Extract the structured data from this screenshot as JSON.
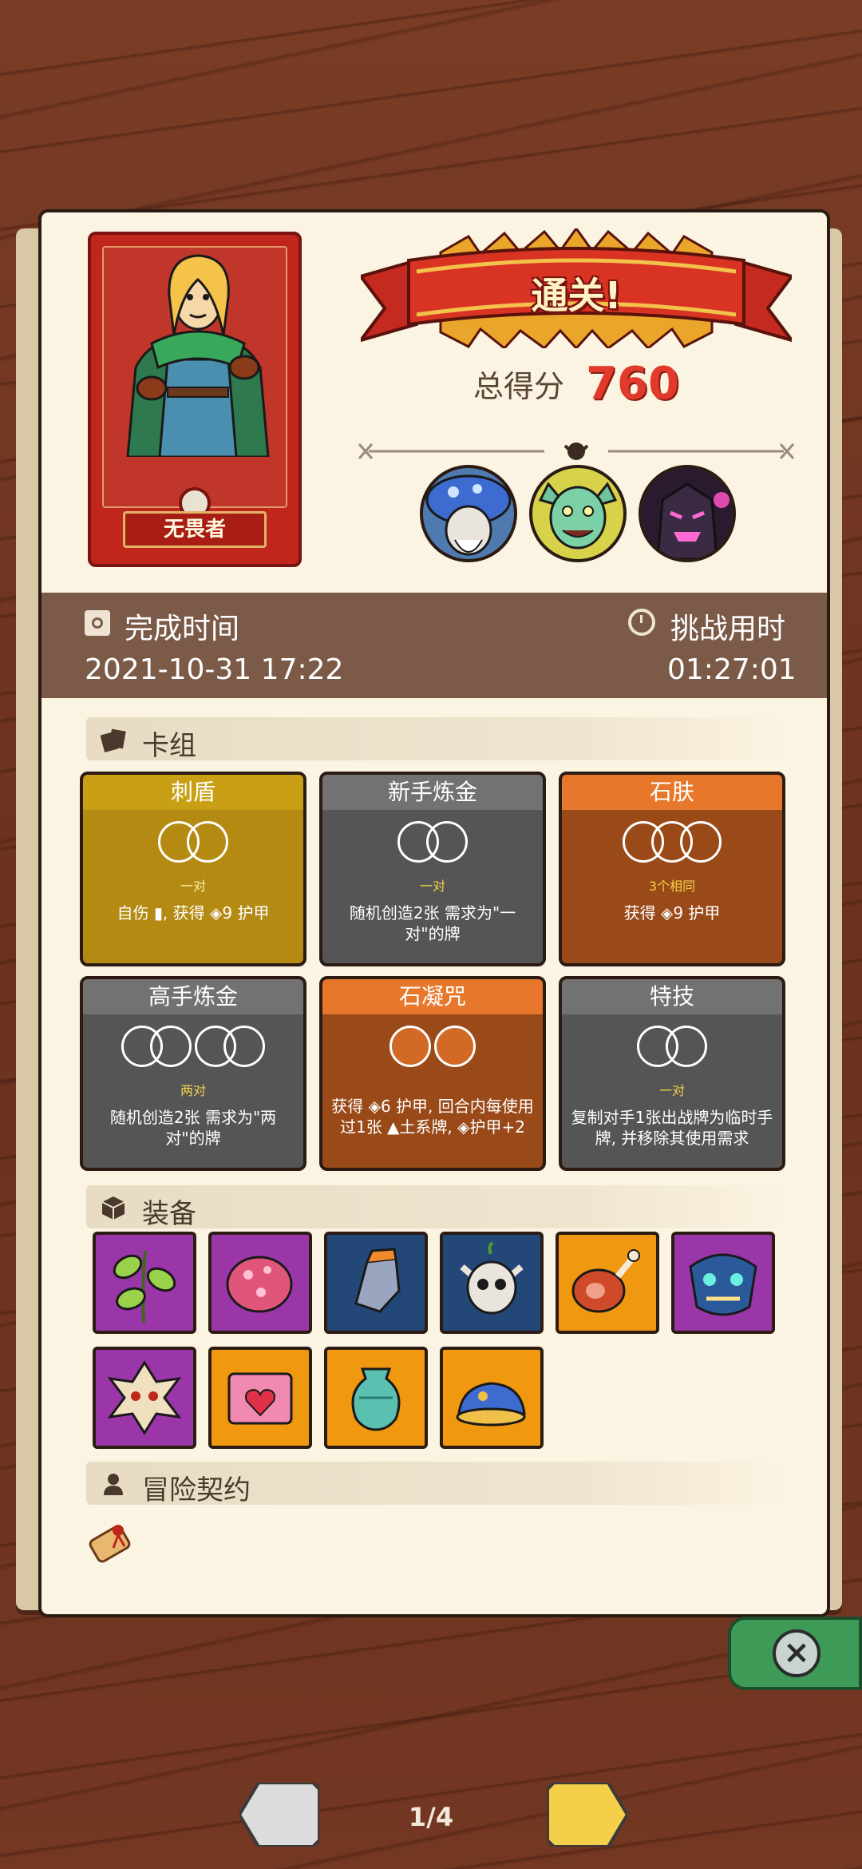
{
  "hero": {
    "name": "无畏者"
  },
  "result": {
    "banner": "通关!",
    "score_label": "总得分",
    "score": "760"
  },
  "times": {
    "finish_label": "完成时间",
    "finish_value": "2021-10-31 17:22",
    "duration_label": "挑战用时",
    "duration_value": "01:27:01"
  },
  "sections": {
    "deck": "卡组",
    "equipment": "装备",
    "contract": "冒险契约"
  },
  "deck": [
    {
      "title": "刺盾",
      "req": "一对",
      "desc": "自伤 ▮, 获得 ◈9 护甲",
      "color": "#b48a12",
      "header": "#c9a015"
    },
    {
      "title": "新手炼金",
      "req": "一对",
      "desc": "随机创造2张 需求为\"一对\"的牌",
      "color": "#555555",
      "header": "#727272"
    },
    {
      "title": "石肤",
      "req": "3个相同",
      "desc": "获得 ◈9 护甲",
      "color": "#9a4a18",
      "header": "#e7772a"
    },
    {
      "title": "高手炼金",
      "req": "两对",
      "desc": "随机创造2张 需求为\"两对\"的牌",
      "color": "#555555",
      "header": "#727272"
    },
    {
      "title": "石凝咒",
      "req": "",
      "desc": "获得 ◈6 护甲, 回合内每使用过1张 ▲土系牌, ◈护甲+2",
      "color": "#9a4a18",
      "header": "#e7772a"
    },
    {
      "title": "特技",
      "req": "一对",
      "desc": "复制对手1张出战牌为临时手牌, 并移除其使用需求",
      "color": "#555555",
      "header": "#727272"
    }
  ],
  "equipment": [
    {
      "icon": "vine-leaves-icon",
      "color": "purple"
    },
    {
      "icon": "mushroom-cap-icon",
      "color": "purple"
    },
    {
      "icon": "gauntlet-icon",
      "color": "navy"
    },
    {
      "icon": "horned-skull-icon",
      "color": "navy"
    },
    {
      "icon": "ham-icon",
      "color": "orange"
    },
    {
      "icon": "demon-mask-icon",
      "color": "purple"
    },
    {
      "icon": "tribal-mask-icon",
      "color": "purple"
    },
    {
      "icon": "heart-chest-icon",
      "color": "orange"
    },
    {
      "icon": "jade-vase-icon",
      "color": "orange"
    },
    {
      "icon": "blue-slime-icon",
      "color": "orange"
    }
  ],
  "pagination": {
    "current": "1/4"
  }
}
